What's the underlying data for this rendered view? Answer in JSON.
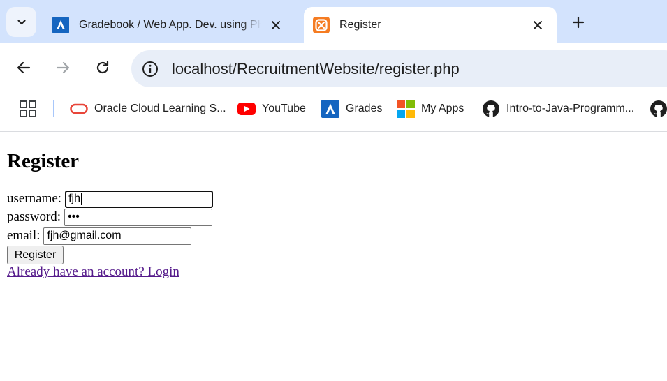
{
  "tabs": [
    {
      "title": "Gradebook / Web App. Dev. using PHP",
      "active": false
    },
    {
      "title": "Register",
      "active": true
    }
  ],
  "address_bar": {
    "url": "localhost/RecruitmentWebsite/register.php"
  },
  "bookmarks": [
    {
      "label": "Oracle Cloud Learning S...",
      "icon": "oracle-icon"
    },
    {
      "label": "YouTube",
      "icon": "youtube-icon"
    },
    {
      "label": "Grades",
      "icon": "grades-icon"
    },
    {
      "label": "My Apps",
      "icon": "microsoft-icon"
    },
    {
      "label": "Intro-to-Java-Programm...",
      "icon": "github-icon"
    }
  ],
  "form": {
    "heading": "Register",
    "username_label": "username:",
    "username_value": "fjh",
    "password_label": "password:",
    "password_value": "•••",
    "email_label": "email:",
    "email_value": "fjh@gmail.com",
    "submit_label": "Register",
    "login_link": "Already have an account? Login"
  },
  "colors": {
    "tab_strip": "#d3e3fd",
    "omnibox": "#e8eef8",
    "link_visited": "#551a8b"
  }
}
